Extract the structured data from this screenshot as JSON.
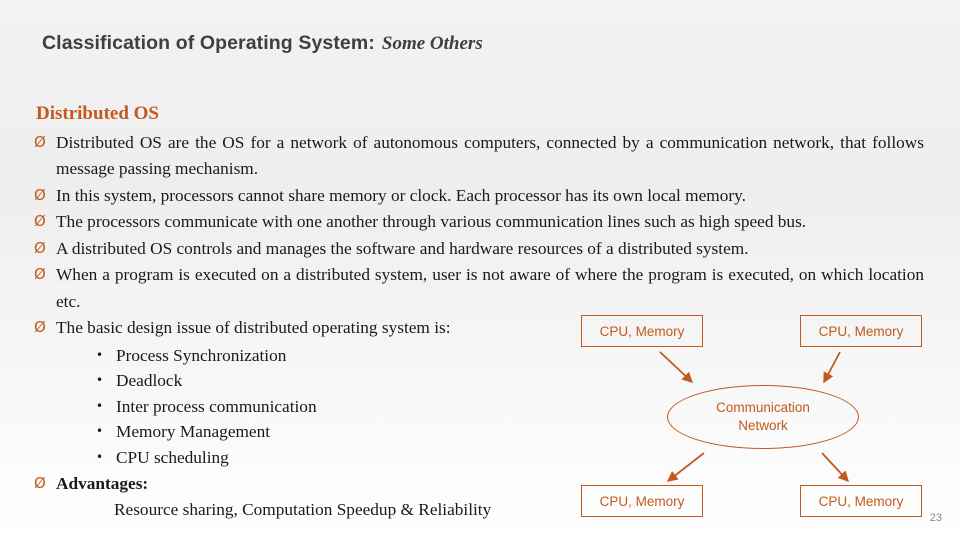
{
  "slide": {
    "title_main": "Classification of Operating System:",
    "title_sub": "Some Others",
    "section_heading": "Distributed OS",
    "bullet_marker": "Ø",
    "sub_marker": "•",
    "page_number": "23",
    "accent_color": "#c25a1e",
    "bullets": [
      "Distributed OS are the OS for a network of autonomous computers, connected by a communication network, that follows message passing mechanism.",
      "In this system, processors cannot share memory or clock. Each processor has its own local memory.",
      "The processors communicate with one another through various communication lines such as high speed bus.",
      "A distributed OS controls and manages the software and hardware resources of a distributed system.",
      "When a program is executed on a distributed system, user is not aware of where the program is executed, on which location etc.",
      "The basic design issue of distributed operating system is:"
    ],
    "sub_bullets": [
      "Process Synchronization",
      "Deadlock",
      "Inter process communication",
      "Memory Management",
      "CPU scheduling"
    ],
    "advantages_label": "Advantages:",
    "advantages_text": "Resource sharing, Computation Speedup & Reliability"
  },
  "diagram": {
    "node_top_left": "CPU, Memory",
    "node_top_right": "CPU, Memory",
    "node_bottom_left": "CPU, Memory",
    "node_bottom_right": "CPU, Memory",
    "center_line1": "Communication",
    "center_line2": "Network"
  }
}
